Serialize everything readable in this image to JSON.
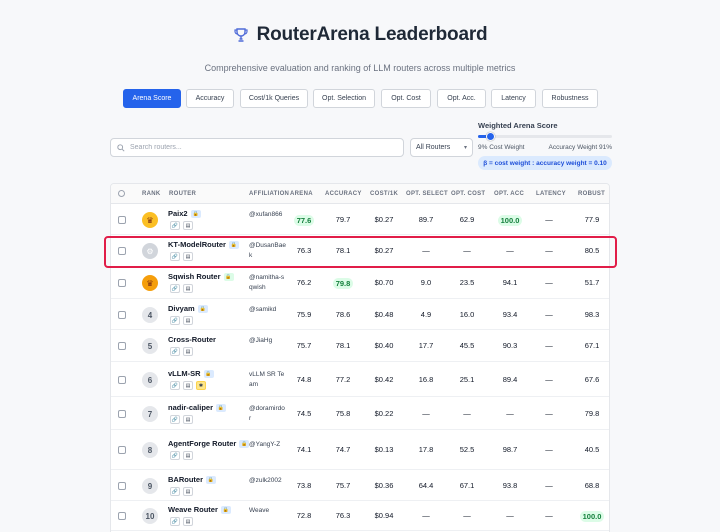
{
  "header": {
    "title": "RouterArena Leaderboard",
    "subtitle": "Comprehensive evaluation and ranking of LLM routers across multiple metrics"
  },
  "tabs": [
    {
      "label": "Arena Score",
      "active": true
    },
    {
      "label": "Accuracy"
    },
    {
      "label": "Cost/1k Queries"
    },
    {
      "label": "Opt. Selection"
    },
    {
      "label": "Opt. Cost"
    },
    {
      "label": "Opt. Acc."
    },
    {
      "label": "Latency"
    },
    {
      "label": "Robustness"
    }
  ],
  "search": {
    "placeholder": "Search routers..."
  },
  "filter": {
    "selected": "All Routers"
  },
  "weight": {
    "title": "Weighted Arena Score",
    "cost_label": "9% Cost Weight",
    "accuracy_label": "Accuracy Weight 91%",
    "cost_fraction": 0.09,
    "formula": "β = cost weight : accuracy weight = 0.10"
  },
  "table": {
    "headers": [
      "RANK",
      "ROUTER",
      "AFFILIATION",
      "ARENA",
      "ACCURACY",
      "COST/1K",
      "OPT. SELECT",
      "OPT. COST",
      "OPT. ACC",
      "LATENCY",
      "ROBUST"
    ],
    "rows": [
      {
        "rank": "1",
        "name": "Paix2",
        "aff": "@xufan866",
        "arena": "77.6",
        "acc": "79.7",
        "cost": "$0.27",
        "osel": "89.7",
        "ocost": "62.9",
        "oacc": "100.0",
        "lat": "—",
        "rob": "77.9"
      },
      {
        "rank": "2",
        "name": "KT-ModelRouter",
        "aff": "@DusanBaek",
        "arena": "76.3",
        "acc": "78.1",
        "cost": "$0.27",
        "osel": "—",
        "ocost": "—",
        "oacc": "—",
        "lat": "—",
        "rob": "80.5"
      },
      {
        "rank": "3",
        "name": "Sqwish Router",
        "aff": "@namitha-sqwish",
        "arena": "76.2",
        "acc": "79.8",
        "cost": "$0.70",
        "osel": "9.0",
        "ocost": "23.5",
        "oacc": "94.1",
        "lat": "—",
        "rob": "51.7"
      },
      {
        "rank": "4",
        "name": "Divyam",
        "aff": "@samikd",
        "arena": "75.9",
        "acc": "78.6",
        "cost": "$0.48",
        "osel": "4.9",
        "ocost": "16.0",
        "oacc": "93.4",
        "lat": "—",
        "rob": "98.3"
      },
      {
        "rank": "5",
        "name": "Cross-Router",
        "aff": "@JiaHg",
        "arena": "75.7",
        "acc": "78.1",
        "cost": "$0.40",
        "osel": "17.7",
        "ocost": "45.5",
        "oacc": "90.3",
        "lat": "—",
        "rob": "67.1"
      },
      {
        "rank": "6",
        "name": "vLLM-SR",
        "aff": "vLLM SR Team",
        "arena": "74.8",
        "acc": "77.2",
        "cost": "$0.42",
        "osel": "16.8",
        "ocost": "25.1",
        "oacc": "89.4",
        "lat": "—",
        "rob": "67.6"
      },
      {
        "rank": "7",
        "name": "nadir-caliper",
        "aff": "@doramirdor",
        "arena": "74.5",
        "acc": "75.8",
        "cost": "$0.22",
        "osel": "—",
        "ocost": "—",
        "oacc": "—",
        "lat": "—",
        "rob": "79.8"
      },
      {
        "rank": "8",
        "name": "AgentForge Router",
        "aff": "@YangY-Z",
        "arena": "74.1",
        "acc": "74.7",
        "cost": "$0.13",
        "osel": "17.8",
        "ocost": "52.5",
        "oacc": "98.7",
        "lat": "—",
        "rob": "40.5"
      },
      {
        "rank": "9",
        "name": "BARouter",
        "aff": "@zulk2002",
        "arena": "73.8",
        "acc": "75.7",
        "cost": "$0.36",
        "osel": "64.4",
        "ocost": "67.1",
        "oacc": "93.8",
        "lat": "—",
        "rob": "68.8"
      },
      {
        "rank": "10",
        "name": "Weave Router",
        "aff": "Weave",
        "arena": "72.8",
        "acc": "76.3",
        "cost": "$0.94",
        "osel": "—",
        "ocost": "—",
        "oacc": "—",
        "lat": "—",
        "rob": "100.0"
      }
    ]
  },
  "colors": {
    "accent": "#2563eb",
    "highlight_border": "#e11d48",
    "good": "#dcfce7"
  }
}
